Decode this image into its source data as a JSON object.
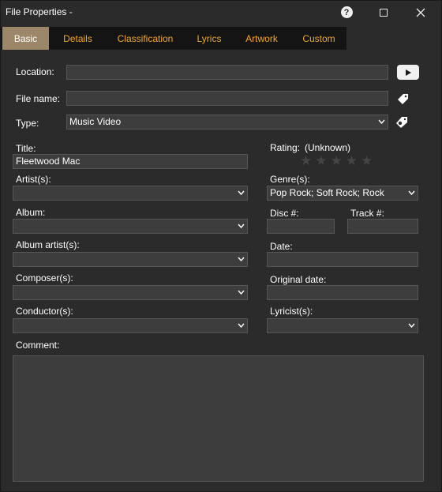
{
  "window": {
    "title": "File Properties -"
  },
  "titlebar": {
    "help_icon": "help-icon",
    "maximize_icon": "maximize-icon",
    "close_icon": "close-icon"
  },
  "tabs": [
    {
      "label": "Basic",
      "active": true
    },
    {
      "label": "Details",
      "active": false
    },
    {
      "label": "Classification",
      "active": false
    },
    {
      "label": "Lyrics",
      "active": false
    },
    {
      "label": "Artwork",
      "active": false
    },
    {
      "label": "Custom",
      "active": false
    }
  ],
  "colors": {
    "background": "#2b2b2b",
    "field": "#3d3d3d",
    "tab_active": "#9c8868",
    "tab_text": "#f5a623",
    "tab_bar": "#141414"
  },
  "fields": {
    "location": {
      "label": "Location:",
      "value": ""
    },
    "file_name": {
      "label": "File name:",
      "value": ""
    },
    "type": {
      "label": "Type:",
      "value": "Music Video"
    },
    "title": {
      "label": "Title:",
      "value": "Fleetwood Mac"
    },
    "artists": {
      "label": "Artist(s):",
      "value": ""
    },
    "album": {
      "label": "Album:",
      "value": ""
    },
    "album_artists": {
      "label": "Album artist(s):",
      "value": ""
    },
    "composers": {
      "label": "Composer(s):",
      "value": ""
    },
    "conductors": {
      "label": "Conductor(s):",
      "value": ""
    },
    "comment": {
      "label": "Comment:",
      "value": ""
    },
    "rating": {
      "label": "Rating:",
      "value": "(Unknown)",
      "stars": 0,
      "max_stars": 5
    },
    "genres": {
      "label": "Genre(s):",
      "value": "Pop Rock; Soft Rock; Rock"
    },
    "disc": {
      "label": "Disc #:",
      "value": ""
    },
    "track": {
      "label": "Track #:",
      "value": ""
    },
    "date": {
      "label": "Date:",
      "value": ""
    },
    "original_date": {
      "label": "Original date:",
      "value": ""
    },
    "lyricists": {
      "label": "Lyricist(s):",
      "value": ""
    }
  },
  "icons": {
    "location_button": "youtube-play-icon",
    "file_name_button": "tag-icon",
    "type_button": "tag-settings-icon"
  }
}
